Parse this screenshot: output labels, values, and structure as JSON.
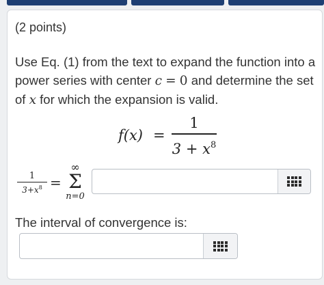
{
  "question": {
    "points": "(2 points)",
    "text_before_c": "Use Eq. (1) from the text to expand the function into a power series with center",
    "center_var": "c",
    "center_eq": "=",
    "center_val": "0",
    "text_after_center": "and determine the set of",
    "var": "x",
    "text_end": "for which the expansion is valid."
  },
  "formula": {
    "lhs": "f(x)",
    "eq": "=",
    "numerator": "1",
    "denominator_base": "3 + x",
    "denominator_exp": "8"
  },
  "series_row": {
    "frac_num": "1",
    "frac_den_base": "3+x",
    "frac_den_exp": "8",
    "eq": "=",
    "sum_upper": "∞",
    "sum_symbol": "Σ",
    "sum_lower": "n=0",
    "input_value": "",
    "palette_icon": "grid-icon"
  },
  "interval": {
    "label": "The interval of convergence is:",
    "input_value": "",
    "palette_icon": "grid-icon"
  },
  "colors": {
    "top_tabs": "#1e3f73",
    "card_background": "#ffffff",
    "page_background": "#eef0f2"
  }
}
